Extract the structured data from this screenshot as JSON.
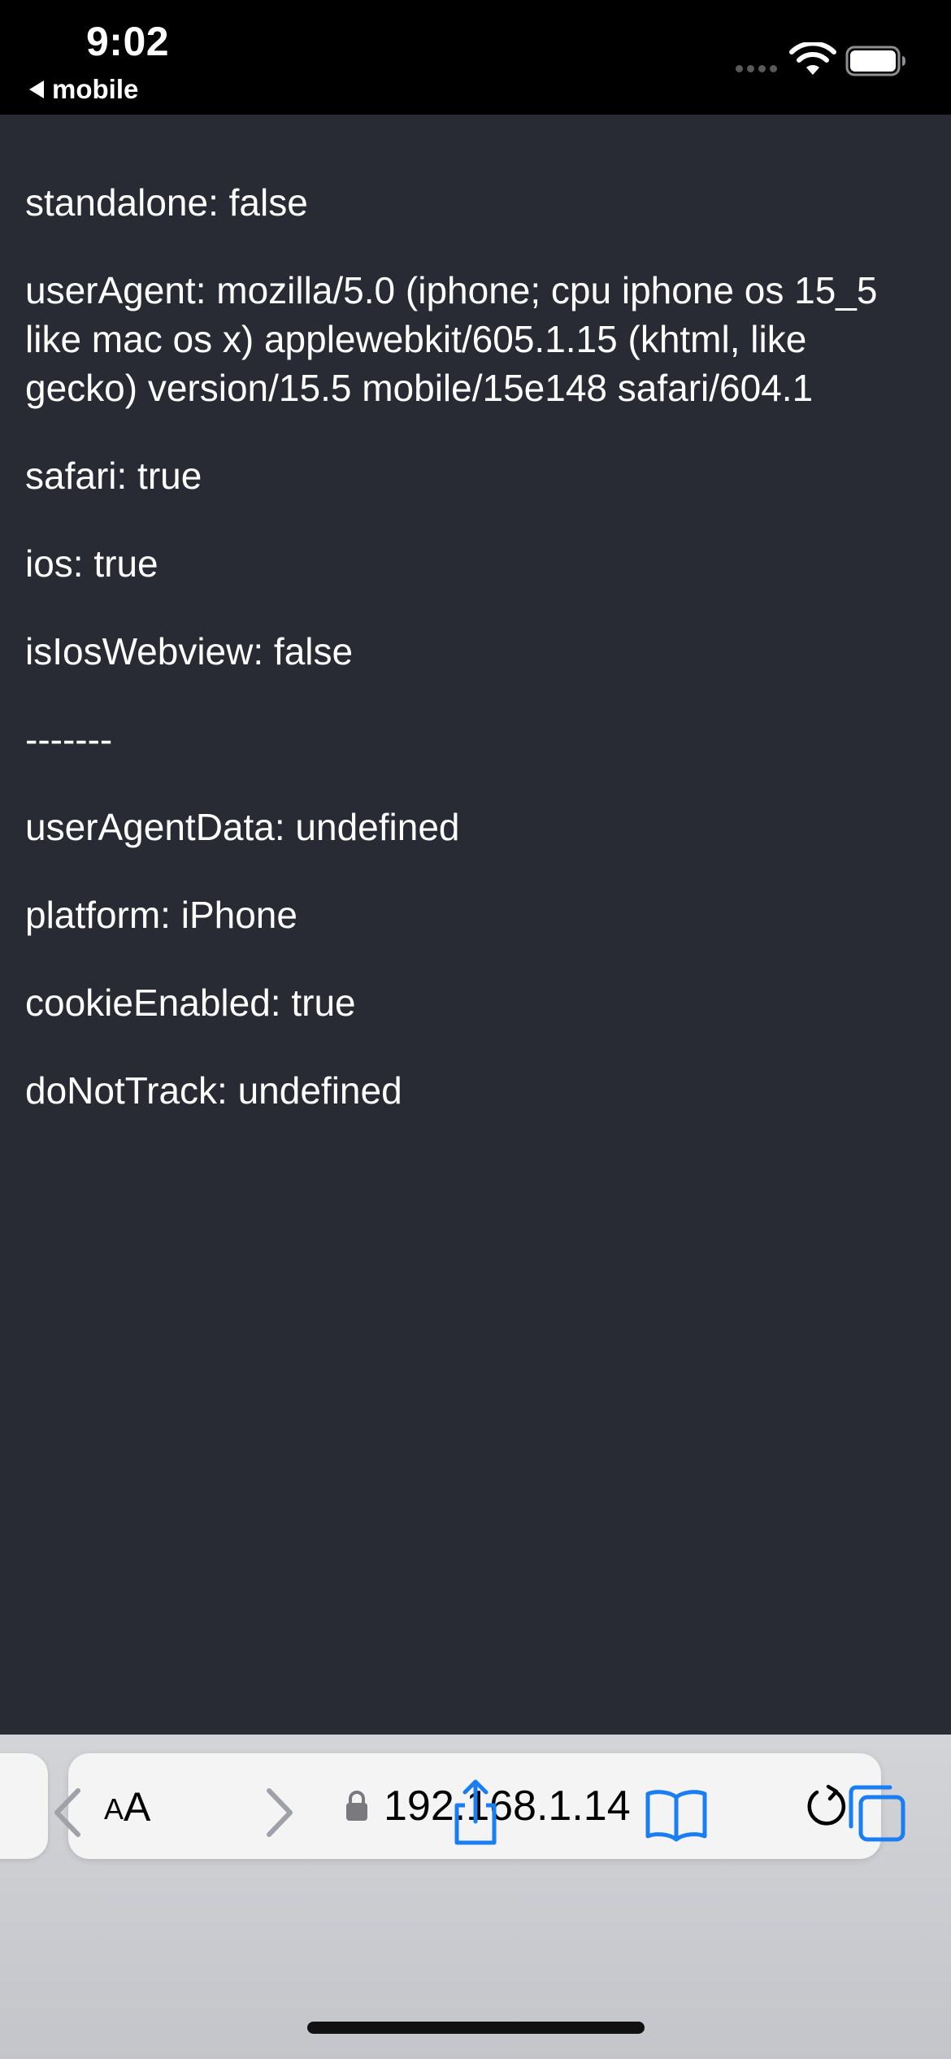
{
  "status_bar": {
    "time": "9:02",
    "back_app_label": "mobile"
  },
  "page": {
    "lines": [
      "standalone: false",
      "userAgent: mozilla/5.0 (iphone; cpu iphone os 15_5 like mac os x) applewebkit/605.1.15 (khtml, like gecko) version/15.5 mobile/15e148 safari/604.1",
      "safari: true",
      "ios: true",
      "isIosWebview: false",
      "-------",
      "userAgentData: undefined",
      "platform: iPhone",
      "cookieEnabled: true",
      "doNotTrack: undefined"
    ]
  },
  "safari": {
    "text_size_small": "A",
    "text_size_large": "A",
    "url": "192.168.1.14"
  },
  "icons": {
    "status": [
      "cellular-signal-icon",
      "wifi-icon",
      "battery-icon"
    ],
    "address_bar": [
      "lock-icon",
      "reload-icon"
    ],
    "toolbar": [
      "back-chevron-icon",
      "forward-chevron-icon",
      "share-icon",
      "bookmarks-icon",
      "tabs-icon"
    ]
  },
  "colors": {
    "page_background": "#282b34",
    "status_bar": "#000000",
    "toolbar_active": "#1a7ef2",
    "toolbar_disabled": "#9ea1a7"
  }
}
